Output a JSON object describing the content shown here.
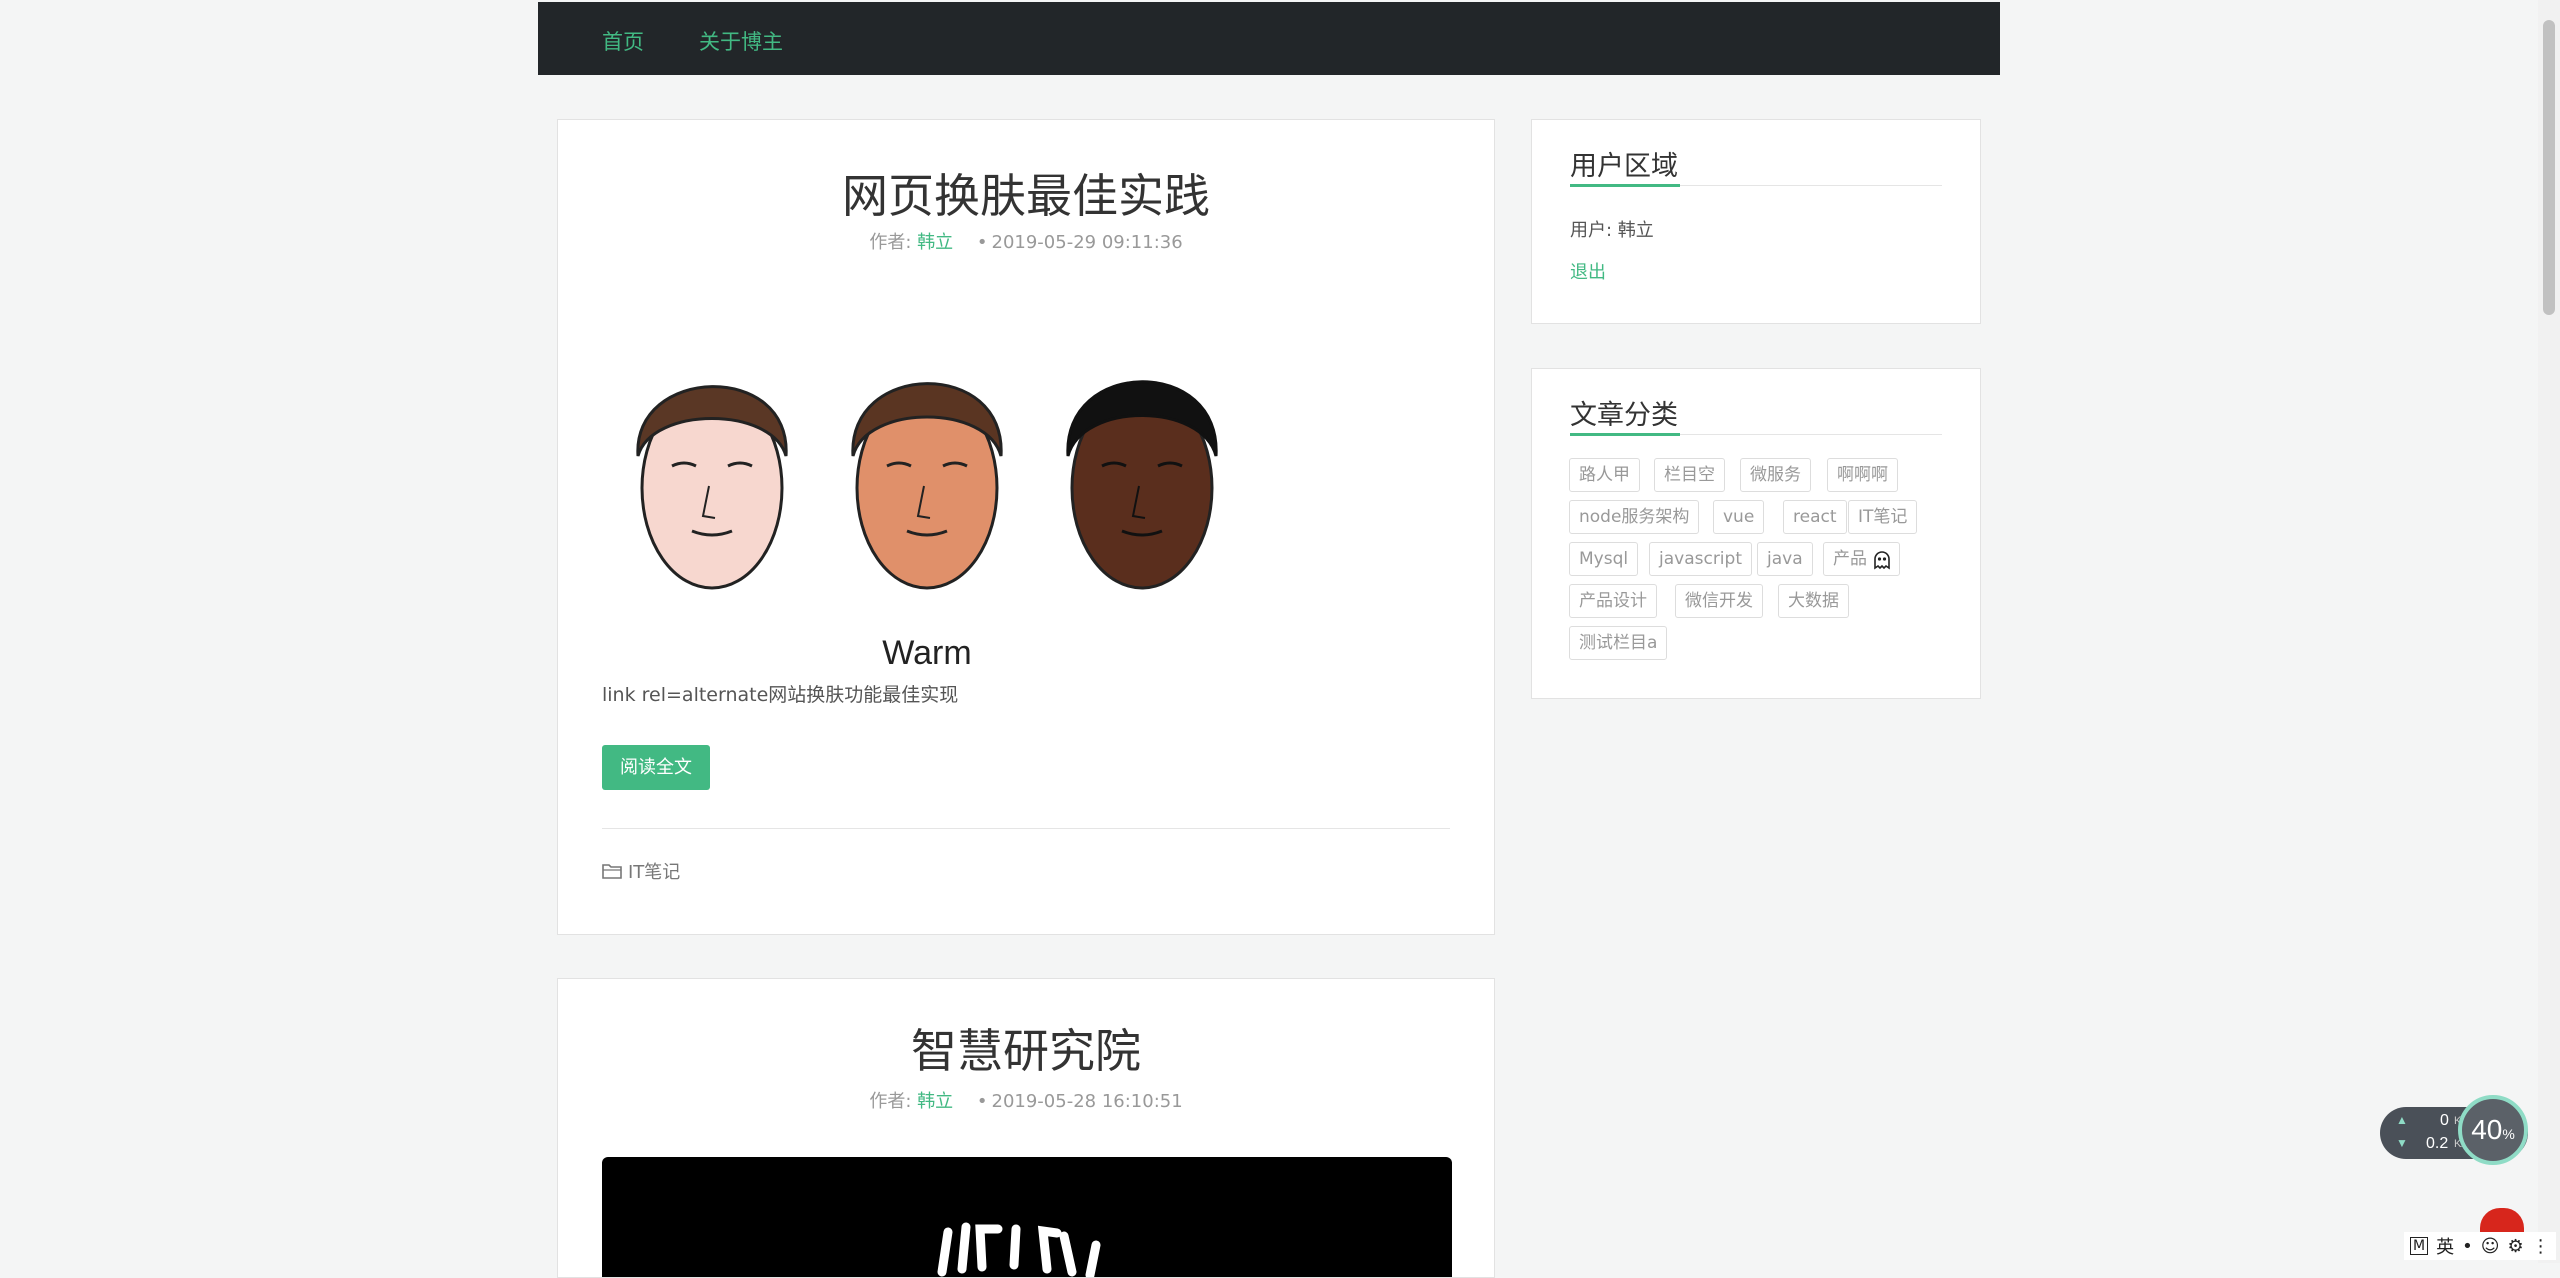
{
  "nav": {
    "items": [
      {
        "label": "首页"
      },
      {
        "label": "关于博主"
      }
    ]
  },
  "posts": [
    {
      "title": "网页换肤最佳实践",
      "author_prefix": "作者:",
      "author": "韩立",
      "date": "2019-05-29 09:11:36",
      "image_caption": "Warm",
      "excerpt": "link rel=alternate网站换肤功能最佳实现",
      "read_more": "阅读全文",
      "category": "IT笔记"
    },
    {
      "title": "智慧研究院",
      "author_prefix": "作者:",
      "author": "韩立",
      "date": "2019-05-28 16:10:51"
    }
  ],
  "user_widget": {
    "title": "用户区域",
    "user_label": "用户: 韩立",
    "logout": "退出"
  },
  "category_widget": {
    "title": "文章分类",
    "tags": [
      "路人甲",
      "栏目空",
      "微服务",
      "啊啊啊",
      "node服务架构",
      "vue",
      "react",
      "IT笔记",
      "Mysql",
      "javascript",
      "java",
      "产品",
      "产品设计",
      "微信开发",
      "大数据",
      "测试栏目a"
    ]
  },
  "speed_widget": {
    "up": "0",
    "up_unit": "K/s",
    "down": "0.2",
    "down_unit": "K/s",
    "percent": "40",
    "percent_unit": "%"
  },
  "ime": {
    "items": [
      "M",
      "英",
      "•",
      "☺",
      "⚙",
      "⋮"
    ]
  },
  "colors": {
    "accent": "#42b983",
    "navbar": "#222629",
    "background": "#f4f5f5"
  }
}
